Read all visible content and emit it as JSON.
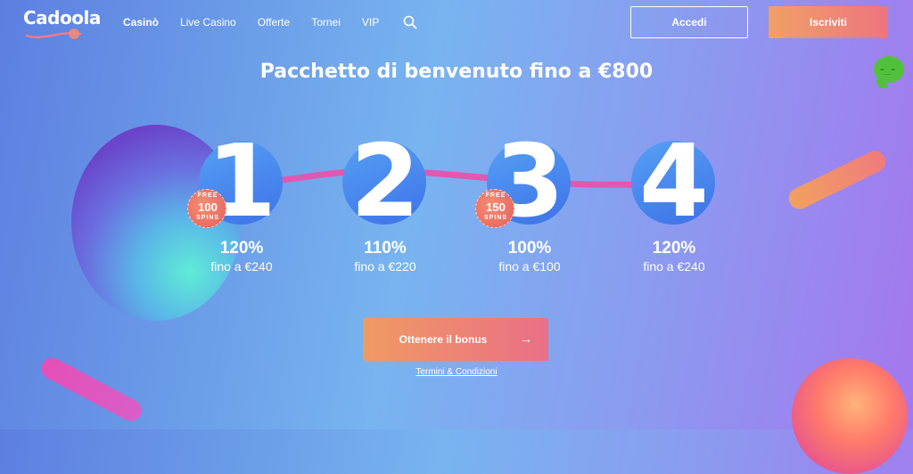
{
  "brand": {
    "name": "Cadoola"
  },
  "nav": {
    "items": [
      {
        "label": "Casinò",
        "active": true
      },
      {
        "label": "Live Casino",
        "active": false
      },
      {
        "label": "Offerte",
        "active": false
      },
      {
        "label": "Tornei",
        "active": false
      },
      {
        "label": "VIP",
        "active": false
      }
    ],
    "search_icon": "search-icon"
  },
  "header": {
    "login_label": "Accedi",
    "signup_label": "Iscriviti"
  },
  "hero": {
    "headline": "Pacchetto di benvenuto fino a €800"
  },
  "steps": [
    {
      "number": "1",
      "percent": "120%",
      "upto": "fino a €240",
      "badge": {
        "top": "FREE",
        "count": "100",
        "bottom": "SPINS"
      }
    },
    {
      "number": "2",
      "percent": "110%",
      "upto": "fino a €220"
    },
    {
      "number": "3",
      "percent": "100%",
      "upto": "fino a €100",
      "badge": {
        "top": "FREE",
        "count": "150",
        "bottom": "SPINS"
      }
    },
    {
      "number": "4",
      "percent": "120%",
      "upto": "fino a €240"
    }
  ],
  "cta": {
    "label": "Ottenere il bonus",
    "arrow": "→"
  },
  "terms": {
    "label": "Termini & Condizioni"
  },
  "chat": {
    "icon": "chat-bubble-icon"
  },
  "colors": {
    "accent_start": "#f09a64",
    "accent_end": "#ea6f86",
    "step_blue": "#3e72e8",
    "chat_green": "#53c03b"
  }
}
